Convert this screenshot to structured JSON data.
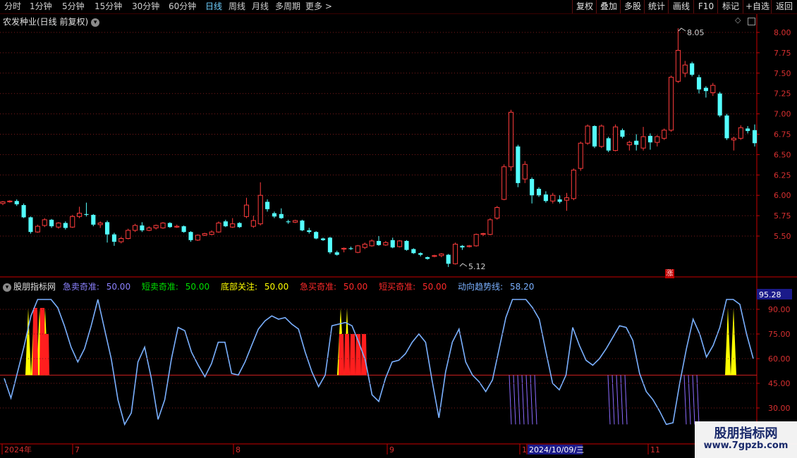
{
  "toolbar": {
    "periods": [
      "分时",
      "1分钟",
      "5分钟",
      "15分钟",
      "30分钟",
      "60分钟",
      "日线",
      "周线",
      "月线",
      "多周期",
      "更多"
    ],
    "active_period": "日线",
    "more_arrow": ">",
    "buttons": [
      "复权",
      "叠加",
      "多股",
      "统计",
      "画线",
      "F10",
      "标记",
      "+自选",
      "返回"
    ]
  },
  "main": {
    "title": "农发种业(日线 前复权)",
    "dropdown_icon": "chevron-down-icon",
    "high_label": "8.05",
    "low_label": "5.12",
    "badge": "涨",
    "y_ticks": [
      "8.00",
      "7.75",
      "7.50",
      "7.25",
      "7.00",
      "6.75",
      "6.50",
      "6.25",
      "6.00",
      "5.75",
      "5.50"
    ],
    "colors": {
      "up": "#ff3c3c",
      "down": "#54ffff",
      "grid": "#7a1a1a",
      "axis": "#c80000"
    }
  },
  "indicator": {
    "name": "股朋指标网",
    "params": [
      {
        "label": "急卖奇准:",
        "value": "50.00",
        "color": "#8c82ff"
      },
      {
        "label": "短卖奇准:",
        "value": "50.00",
        "color": "#00e000"
      },
      {
        "label": "底部关注:",
        "value": "50.00",
        "color": "#ffff00"
      },
      {
        "label": "急买奇准:",
        "value": "50.00",
        "color": "#ff2a2a"
      },
      {
        "label": "短买奇准:",
        "value": "50.00",
        "color": "#ff2a2a"
      },
      {
        "label": "动向趋势线:",
        "value": "58.20",
        "color": "#7ab0ff"
      }
    ],
    "y_ticks": [
      "95.28",
      "90.00",
      "75.00",
      "60.00",
      "45.00",
      "30.00"
    ],
    "current_value": "95.28"
  },
  "time_axis": {
    "labels": [
      "2024年",
      "7",
      "8",
      "9",
      "1",
      "2024/10/09/三",
      "11"
    ],
    "highlight": "2024/10/09/三"
  },
  "watermark": {
    "title": "股朋指标网",
    "url": "www.7gpzb.com"
  },
  "chart_data": [
    {
      "type": "candlestick",
      "title": "农发种业(日线 前复权)",
      "ylim": [
        5.12,
        8.05
      ],
      "candles": [
        {
          "o": 5.9,
          "c": 5.92,
          "h": 5.93,
          "l": 5.88
        },
        {
          "o": 5.92,
          "c": 5.93,
          "h": 5.94,
          "l": 5.91
        },
        {
          "o": 5.93,
          "c": 5.89,
          "h": 5.95,
          "l": 5.87
        },
        {
          "o": 5.88,
          "c": 5.73,
          "h": 5.9,
          "l": 5.72
        },
        {
          "o": 5.73,
          "c": 5.55,
          "h": 5.74,
          "l": 5.53
        },
        {
          "o": 5.55,
          "c": 5.62,
          "h": 5.64,
          "l": 5.54
        },
        {
          "o": 5.63,
          "c": 5.7,
          "h": 5.72,
          "l": 5.61
        },
        {
          "o": 5.7,
          "c": 5.62,
          "h": 5.71,
          "l": 5.6
        },
        {
          "o": 5.61,
          "c": 5.66,
          "h": 5.67,
          "l": 5.59
        },
        {
          "o": 5.66,
          "c": 5.6,
          "h": 5.68,
          "l": 5.58
        },
        {
          "o": 5.61,
          "c": 5.74,
          "h": 5.76,
          "l": 5.6
        },
        {
          "o": 5.74,
          "c": 5.78,
          "h": 5.86,
          "l": 5.72
        },
        {
          "o": 5.77,
          "c": 5.76,
          "h": 5.91,
          "l": 5.74
        },
        {
          "o": 5.76,
          "c": 5.64,
          "h": 5.77,
          "l": 5.62
        },
        {
          "o": 5.64,
          "c": 5.66,
          "h": 5.68,
          "l": 5.6
        },
        {
          "o": 5.67,
          "c": 5.52,
          "h": 5.69,
          "l": 5.42
        },
        {
          "o": 5.52,
          "c": 5.43,
          "h": 5.54,
          "l": 5.38
        },
        {
          "o": 5.43,
          "c": 5.47,
          "h": 5.49,
          "l": 5.41
        },
        {
          "o": 5.47,
          "c": 5.57,
          "h": 5.59,
          "l": 5.46
        },
        {
          "o": 5.57,
          "c": 5.63,
          "h": 5.65,
          "l": 5.55
        },
        {
          "o": 5.63,
          "c": 5.57,
          "h": 5.67,
          "l": 5.55
        },
        {
          "o": 5.57,
          "c": 5.6,
          "h": 5.62,
          "l": 5.56
        },
        {
          "o": 5.6,
          "c": 5.63,
          "h": 5.64,
          "l": 5.58
        },
        {
          "o": 5.6,
          "c": 5.66,
          "h": 5.67,
          "l": 5.59
        },
        {
          "o": 5.66,
          "c": 5.61,
          "h": 5.67,
          "l": 5.6
        },
        {
          "o": 5.61,
          "c": 5.62,
          "h": 5.64,
          "l": 5.6
        },
        {
          "o": 5.62,
          "c": 5.55,
          "h": 5.63,
          "l": 5.54
        },
        {
          "o": 5.55,
          "c": 5.45,
          "h": 5.56,
          "l": 5.43
        },
        {
          "o": 5.45,
          "c": 5.51,
          "h": 5.52,
          "l": 5.44
        },
        {
          "o": 5.51,
          "c": 5.53,
          "h": 5.54,
          "l": 5.5
        },
        {
          "o": 5.52,
          "c": 5.55,
          "h": 5.57,
          "l": 5.51
        },
        {
          "o": 5.55,
          "c": 5.66,
          "h": 5.68,
          "l": 5.54
        },
        {
          "o": 5.68,
          "c": 5.62,
          "h": 5.7,
          "l": 5.61
        },
        {
          "o": 5.61,
          "c": 5.65,
          "h": 5.72,
          "l": 5.6
        },
        {
          "o": 5.66,
          "c": 5.61,
          "h": 5.67,
          "l": 5.6
        },
        {
          "o": 5.74,
          "c": 5.88,
          "h": 5.97,
          "l": 5.72
        },
        {
          "o": 5.62,
          "c": 5.69,
          "h": 5.75,
          "l": 5.6
        },
        {
          "o": 5.65,
          "c": 6.0,
          "h": 6.16,
          "l": 5.63
        },
        {
          "o": 5.92,
          "c": 5.83,
          "h": 5.95,
          "l": 5.8
        },
        {
          "o": 5.78,
          "c": 5.74,
          "h": 5.8,
          "l": 5.72
        },
        {
          "o": 5.77,
          "c": 5.72,
          "h": 5.84,
          "l": 5.71
        },
        {
          "o": 5.68,
          "c": 5.67,
          "h": 5.7,
          "l": 5.65
        },
        {
          "o": 5.67,
          "c": 5.69,
          "h": 5.7,
          "l": 5.66
        },
        {
          "o": 5.69,
          "c": 5.57,
          "h": 5.7,
          "l": 5.56
        },
        {
          "o": 5.57,
          "c": 5.55,
          "h": 5.6,
          "l": 5.53
        },
        {
          "o": 5.55,
          "c": 5.47,
          "h": 5.56,
          "l": 5.46
        },
        {
          "o": 5.47,
          "c": 5.45,
          "h": 5.48,
          "l": 5.44
        },
        {
          "o": 5.48,
          "c": 5.3,
          "h": 5.49,
          "l": 5.28
        },
        {
          "o": 5.3,
          "c": 5.27,
          "h": 5.32,
          "l": 5.26
        },
        {
          "o": 5.34,
          "c": 5.35,
          "h": 5.36,
          "l": 5.3
        },
        {
          "o": 5.35,
          "c": 5.34,
          "h": 5.37,
          "l": 5.33
        },
        {
          "o": 5.3,
          "c": 5.38,
          "h": 5.39,
          "l": 5.29
        },
        {
          "o": 5.36,
          "c": 5.4,
          "h": 5.42,
          "l": 5.34
        },
        {
          "o": 5.38,
          "c": 5.44,
          "h": 5.46,
          "l": 5.37
        },
        {
          "o": 5.44,
          "c": 5.39,
          "h": 5.5,
          "l": 5.38
        },
        {
          "o": 5.39,
          "c": 5.42,
          "h": 5.44,
          "l": 5.38
        },
        {
          "o": 5.45,
          "c": 5.36,
          "h": 5.48,
          "l": 5.35
        },
        {
          "o": 5.37,
          "c": 5.44,
          "h": 5.45,
          "l": 5.36
        },
        {
          "o": 5.44,
          "c": 5.33,
          "h": 5.45,
          "l": 5.32
        },
        {
          "o": 5.34,
          "c": 5.29,
          "h": 5.35,
          "l": 5.28
        },
        {
          "o": 5.29,
          "c": 5.27,
          "h": 5.3,
          "l": 5.25
        },
        {
          "o": 5.24,
          "c": 5.22,
          "h": 5.25,
          "l": 5.21
        },
        {
          "o": 5.25,
          "c": 5.26,
          "h": 5.27,
          "l": 5.24
        },
        {
          "o": 5.26,
          "c": 5.28,
          "h": 5.29,
          "l": 5.24
        },
        {
          "o": 5.27,
          "c": 5.16,
          "h": 5.28,
          "l": 5.12
        },
        {
          "o": 5.16,
          "c": 5.4,
          "h": 5.42,
          "l": 5.15
        },
        {
          "o": 5.38,
          "c": 5.36,
          "h": 5.39,
          "l": 5.33
        },
        {
          "o": 5.37,
          "c": 5.38,
          "h": 5.39,
          "l": 5.36
        },
        {
          "o": 5.38,
          "c": 5.52,
          "h": 5.53,
          "l": 5.37
        },
        {
          "o": 5.52,
          "c": 5.53,
          "h": 5.54,
          "l": 5.5
        },
        {
          "o": 5.52,
          "c": 5.7,
          "h": 5.72,
          "l": 5.51
        },
        {
          "o": 5.72,
          "c": 5.85,
          "h": 5.87,
          "l": 5.7
        },
        {
          "o": 5.95,
          "c": 6.35,
          "h": 6.38,
          "l": 5.94
        },
        {
          "o": 6.35,
          "c": 7.02,
          "h": 7.05,
          "l": 6.3
        },
        {
          "o": 6.6,
          "c": 6.15,
          "h": 6.62,
          "l": 6.1
        },
        {
          "o": 6.2,
          "c": 6.38,
          "h": 6.42,
          "l": 6.15
        },
        {
          "o": 6.2,
          "c": 6.0,
          "h": 6.22,
          "l": 5.9
        },
        {
          "o": 6.08,
          "c": 6.0,
          "h": 6.1,
          "l": 5.98
        },
        {
          "o": 6.01,
          "c": 5.93,
          "h": 6.05,
          "l": 5.91
        },
        {
          "o": 5.93,
          "c": 6.0,
          "h": 6.03,
          "l": 5.9
        },
        {
          "o": 5.95,
          "c": 5.92,
          "h": 6.0,
          "l": 5.9
        },
        {
          "o": 5.94,
          "c": 5.97,
          "h": 6.03,
          "l": 5.81
        },
        {
          "o": 5.96,
          "c": 6.31,
          "h": 6.33,
          "l": 5.94
        },
        {
          "o": 6.33,
          "c": 6.64,
          "h": 6.66,
          "l": 6.3
        },
        {
          "o": 6.64,
          "c": 6.85,
          "h": 6.87,
          "l": 6.62
        },
        {
          "o": 6.85,
          "c": 6.6,
          "h": 6.86,
          "l": 6.58
        },
        {
          "o": 6.6,
          "c": 6.85,
          "h": 6.87,
          "l": 6.58
        },
        {
          "o": 6.7,
          "c": 6.55,
          "h": 6.72,
          "l": 6.53
        },
        {
          "o": 6.55,
          "c": 6.84,
          "h": 6.87,
          "l": 6.54
        },
        {
          "o": 6.8,
          "c": 6.72,
          "h": 6.82,
          "l": 6.7
        },
        {
          "o": 6.62,
          "c": 6.65,
          "h": 6.67,
          "l": 6.55
        },
        {
          "o": 6.67,
          "c": 6.62,
          "h": 6.75,
          "l": 6.55
        },
        {
          "o": 6.58,
          "c": 6.72,
          "h": 6.84,
          "l": 6.55
        },
        {
          "o": 6.73,
          "c": 6.65,
          "h": 6.76,
          "l": 6.56
        },
        {
          "o": 6.65,
          "c": 6.72,
          "h": 6.74,
          "l": 6.6
        },
        {
          "o": 6.7,
          "c": 6.8,
          "h": 6.82,
          "l": 6.68
        },
        {
          "o": 6.8,
          "c": 7.45,
          "h": 7.47,
          "l": 6.78
        },
        {
          "o": 7.4,
          "c": 7.78,
          "h": 8.05,
          "l": 7.38
        },
        {
          "o": 7.5,
          "c": 7.6,
          "h": 7.65,
          "l": 7.45
        },
        {
          "o": 7.62,
          "c": 7.48,
          "h": 7.64,
          "l": 7.46
        },
        {
          "o": 7.45,
          "c": 7.3,
          "h": 7.48,
          "l": 7.25
        },
        {
          "o": 7.32,
          "c": 7.28,
          "h": 7.34,
          "l": 7.2
        },
        {
          "o": 7.26,
          "c": 7.35,
          "h": 7.38,
          "l": 7.22
        },
        {
          "o": 7.25,
          "c": 6.98,
          "h": 7.27,
          "l": 6.96
        },
        {
          "o": 6.98,
          "c": 6.7,
          "h": 7.0,
          "l": 6.68
        },
        {
          "o": 6.68,
          "c": 6.7,
          "h": 6.72,
          "l": 6.55
        },
        {
          "o": 6.7,
          "c": 6.83,
          "h": 6.86,
          "l": 6.68
        },
        {
          "o": 6.82,
          "c": 6.79,
          "h": 6.85,
          "l": 6.76
        },
        {
          "o": 6.8,
          "c": 6.64,
          "h": 6.87,
          "l": 6.6
        }
      ]
    },
    {
      "type": "line",
      "series": [
        {
          "name": "动向趋势线",
          "values": [
            48,
            36,
            52,
            68,
            86,
            96,
            96,
            96,
            91,
            80,
            67,
            58,
            66,
            80,
            96,
            78,
            60,
            35,
            20,
            27,
            58,
            67,
            48,
            23,
            35,
            60,
            79,
            77,
            64,
            56,
            49,
            57,
            70,
            70,
            51,
            50,
            58,
            68,
            78,
            83,
            86,
            84,
            85,
            81,
            78,
            64,
            52,
            43,
            50,
            80,
            81,
            82,
            80,
            70,
            59,
            38,
            34,
            48,
            58,
            59,
            63,
            70,
            75,
            70,
            46,
            24,
            52,
            70,
            78,
            58,
            50,
            46,
            40,
            47,
            66,
            85,
            96,
            96,
            96,
            91,
            84,
            64,
            45,
            41,
            50,
            79,
            68,
            59,
            56,
            60,
            66,
            73,
            80,
            79,
            71,
            51,
            40,
            35,
            28,
            20,
            21,
            45,
            66,
            84,
            75,
            61,
            68,
            79,
            96,
            96,
            93,
            75,
            60
          ]
        }
      ],
      "ylim": [
        20,
        96
      ],
      "reference_line": 50
    }
  ]
}
